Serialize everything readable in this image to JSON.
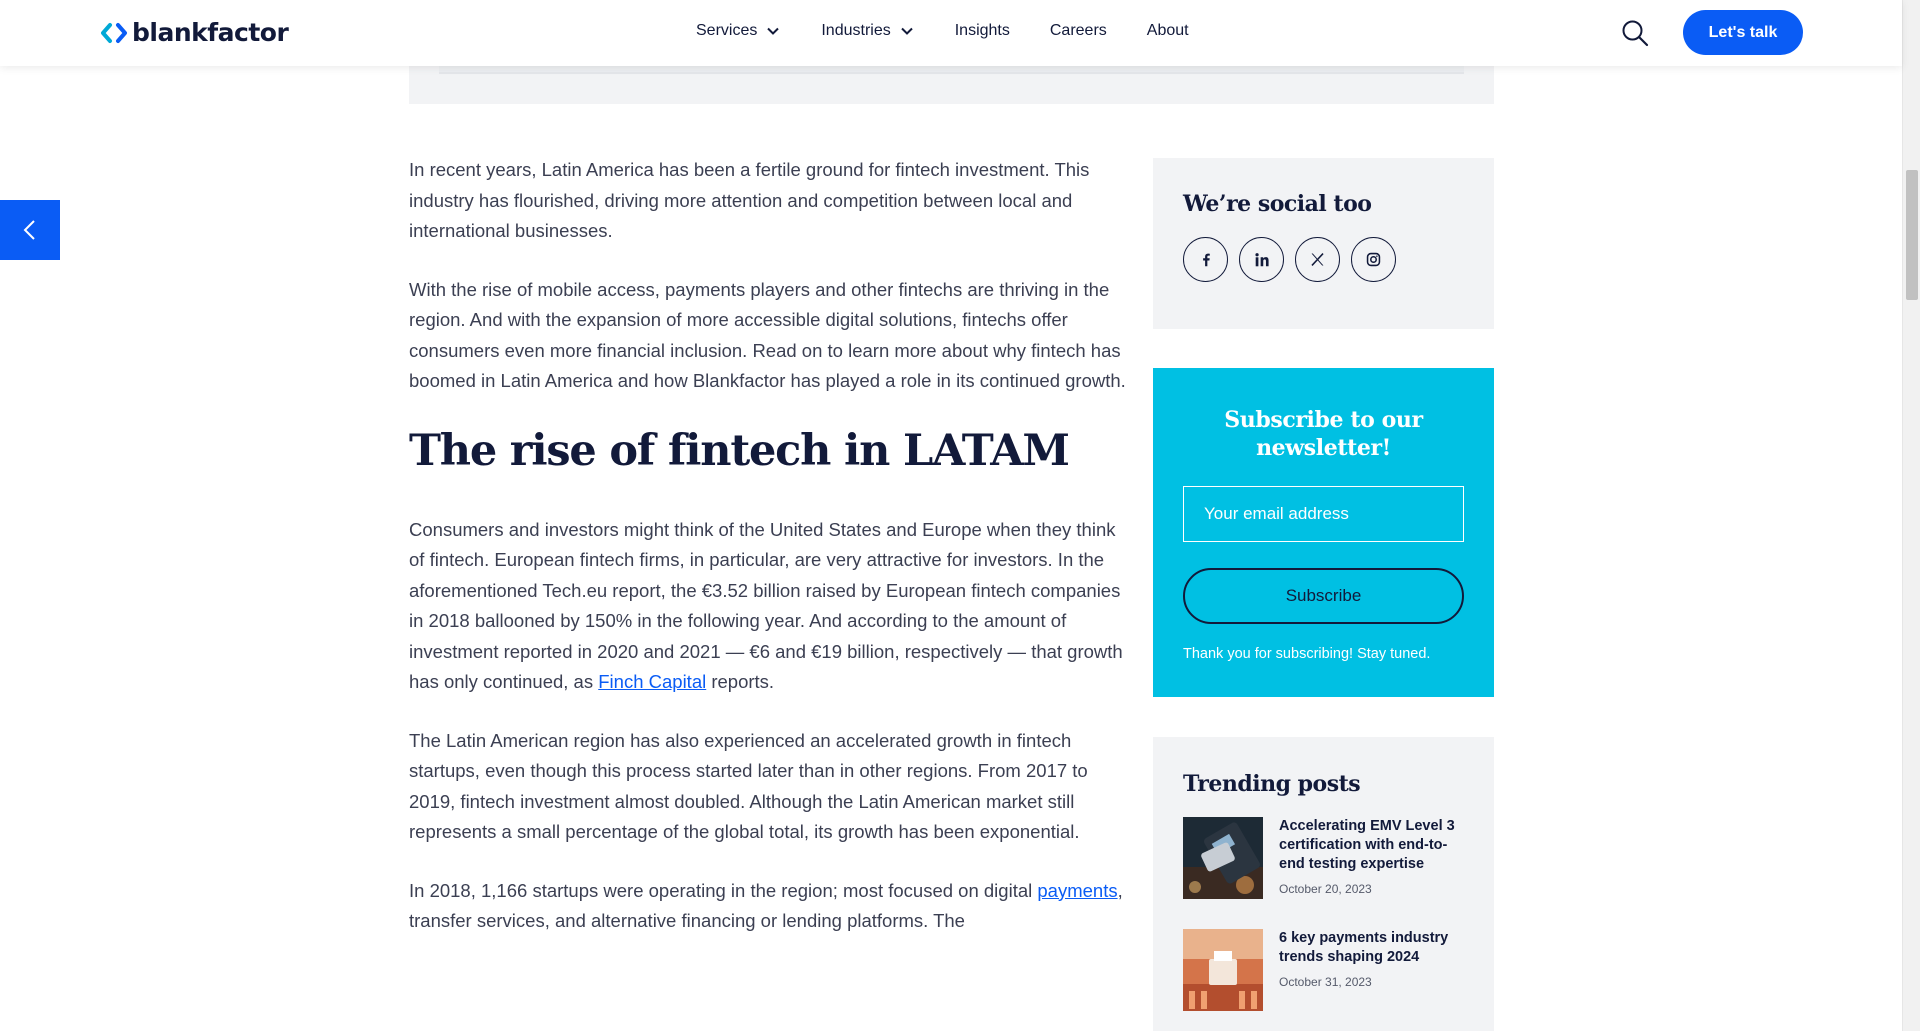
{
  "header": {
    "brand": "blankfactor",
    "nav": [
      {
        "label": "Services",
        "dropdown": true
      },
      {
        "label": "Industries",
        "dropdown": true
      },
      {
        "label": "Insights",
        "dropdown": false
      },
      {
        "label": "Careers",
        "dropdown": false
      },
      {
        "label": "About",
        "dropdown": false
      }
    ],
    "cta": "Let's talk"
  },
  "article": {
    "p1": "In recent years, Latin America has been a fertile ground for fintech investment. This industry has flourished, driving more attention and competition between local and international businesses.",
    "p2": "With the rise of mobile access, payments players and other fintechs are thriving in the region. And with the expansion of more accessible digital solutions, fintechs offer consumers even more financial inclusion. Read on to learn more about why fintech has boomed in Latin America and how Blankfactor has played a role in its continued growth.",
    "heading": "The rise of fintech in LATAM",
    "p3_before": "Consumers and investors might think of the United States and Europe when they think of fintech. European fintech firms, in particular, are very attractive for investors. In the aforementioned Tech.eu report, the €3.52 billion raised by European fintech companies in 2018 ballooned by 150% in the following year. And according to the amount of investment reported in 2020 and 2021 — €6 and €19 billion, respectively — that growth has only continued, as ",
    "p3_link": "Finch Capital",
    "p3_after": " reports.",
    "p4": "The Latin American region has also experienced an accelerated growth in fintech startups, even though this process started later than in other regions. From 2017 to 2019, fintech investment almost doubled. Although the Latin American market still represents a small percentage of the global total, its growth has been exponential.",
    "p5_before": "In 2018, 1,166 startups were operating in the region; most focused on digital ",
    "p5_link": "payments",
    "p5_after": ", transfer services, and alternative financing or lending platforms. The"
  },
  "sidebar": {
    "social": {
      "title": "We’re social too",
      "icons": [
        "facebook-icon",
        "linkedin-icon",
        "x-icon",
        "instagram-icon"
      ]
    },
    "newsletter": {
      "title": "Subscribe to our newsletter!",
      "placeholder": "Your email address",
      "button": "Subscribe",
      "thanks": "Thank you for subscribing! Stay tuned."
    },
    "trending": {
      "title": "Trending posts",
      "posts": [
        {
          "title": "Accelerating EMV Level 3 certification with end-to-end testing expertise",
          "date": "October 20, 2023"
        },
        {
          "title": "6 key payments industry trends shaping 2024",
          "date": "October 31, 2023"
        }
      ]
    }
  },
  "colors": {
    "primary": "#0a5cf5",
    "navy": "#121a3a",
    "cyan": "#00c0e3",
    "panel": "#f2f3f5"
  }
}
